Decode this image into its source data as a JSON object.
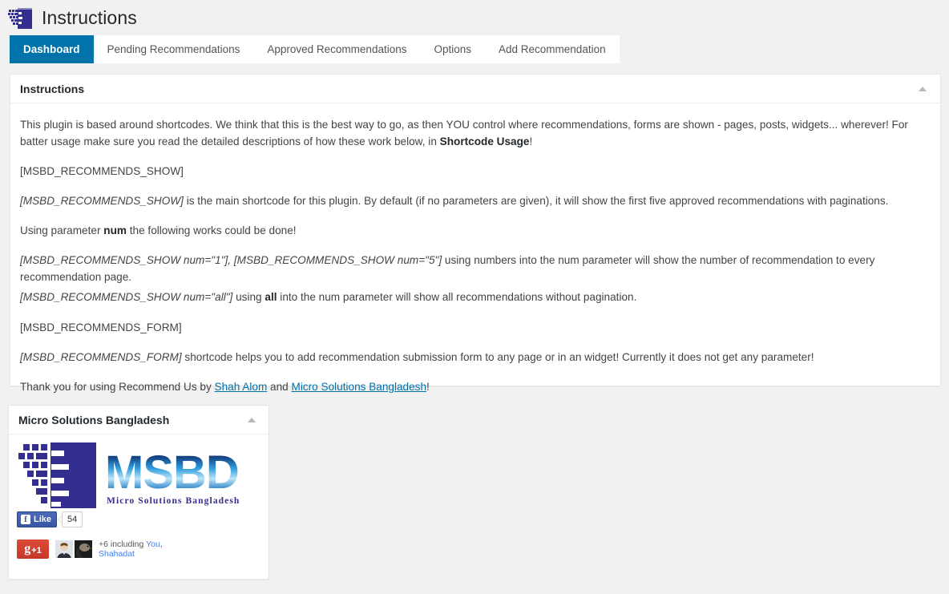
{
  "header": {
    "title": "Instructions",
    "icon": "msbd-pixel-logo-icon"
  },
  "tabs": [
    {
      "label": "Dashboard",
      "active": true
    },
    {
      "label": "Pending Recommendations",
      "active": false
    },
    {
      "label": "Approved Recommendations",
      "active": false
    },
    {
      "label": "Options",
      "active": false
    },
    {
      "label": "Add Recommendation",
      "active": false
    }
  ],
  "instructions_panel": {
    "title": "Instructions",
    "toggle_icon": "triangle-up-icon",
    "paragraphs": {
      "intro_a": "This plugin is based around shortcodes. We think that this is the best way to go, as then YOU control where recommendations, forms are shown - pages, posts, widgets... wherever! For batter usage make sure you read the detailed descriptions of how these work below, in ",
      "intro_bold": "Shortcode Usage",
      "intro_b": "!",
      "code_show": "[MSBD_RECOMMENDS_SHOW]",
      "show_desc_em": "[MSBD_RECOMMENDS_SHOW]",
      "show_desc_rest": " is the main shortcode for this plugin. By default (if no parameters are given), it will show the first five approved recommendations with paginations.",
      "param_a": "Using parameter ",
      "param_bold": "num",
      "param_b": " the following works could be done!",
      "num_example_em": "[MSBD_RECOMMENDS_SHOW num=\"1\"], [MSBD_RECOMMENDS_SHOW num=\"5\"]",
      "num_example_rest": " using numbers into the num parameter will show the number of recommendation to every recommendation page.",
      "all_example_em": "[MSBD_RECOMMENDS_SHOW num=\"all\"]",
      "all_example_mid": " using ",
      "all_example_bold": "all",
      "all_example_rest": " into the num parameter will show all recommendations without pagination.",
      "code_form": "[MSBD_RECOMMENDS_FORM]",
      "form_desc_em": "[MSBD_RECOMMENDS_FORM]",
      "form_desc_rest": " shortcode helps you to add recommendation submission form to any page or in an widget! Currently it does not get any parameter!",
      "thanks_a": "Thank you for using Recommend Us by ",
      "thanks_link1": "Shah Alom",
      "thanks_mid": " and ",
      "thanks_link2": "Micro Solutions Bangladesh",
      "thanks_b": "!"
    }
  },
  "msbd_panel": {
    "title": "Micro Solutions Bangladesh",
    "toggle_icon": "triangle-up-icon",
    "logo": {
      "wordmark": "MSBD",
      "tagline": "Micro Solutions Bangladesh"
    },
    "facebook": {
      "icon": "facebook-f-icon",
      "like_label": "Like",
      "count": "54"
    },
    "google_plus": {
      "button_g": "g",
      "button_plus": "+1",
      "text_prefix": "+6 including ",
      "link_you": "You",
      "text_sep": ", ",
      "link_shahadat": "Shahadat"
    }
  },
  "colors": {
    "page_background": "#f1f1f1",
    "panel_background": "#ffffff",
    "active_tab": "#0073aa",
    "link": "#0073aa",
    "heading_text": "#23282d",
    "body_text": "#444444",
    "brand_blue": "#332e8f",
    "facebook_blue": "#4267b2",
    "google_red": "#d34836"
  }
}
